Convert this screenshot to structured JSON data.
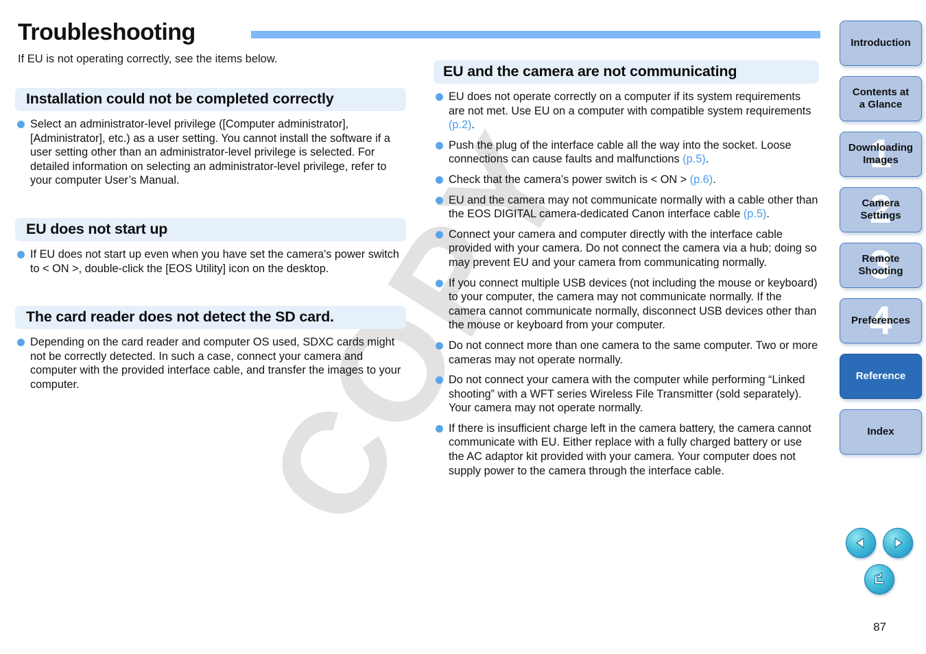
{
  "document": {
    "title": "Troubleshooting",
    "subtitle": "If EU is not operating correctly, see the items below.",
    "page_number": "87",
    "watermark": "COPY",
    "accent_color": "#7fb9f7",
    "section_head_bg": "#e6f0fb",
    "bullet_color": "#5aa4ea",
    "link_color": "#4a9bea",
    "active_tab_color": "#2b6cb8"
  },
  "left_column": {
    "sections": [
      {
        "heading": "Installation could not be completed correctly",
        "bullets": [
          "Select an administrator-level privilege ([Computer administrator], [Administrator], etc.) as a user setting. You cannot install the software if a user setting other than an administrator-level privilege is selected. For detailed information on selecting an administrator-level privilege, refer to your computer User’s Manual."
        ]
      },
      {
        "heading": "EU does not start up",
        "bullets": [
          "If EU does not start up even when you have set the camera's power switch to < ON >, double-click the [EOS Utility] icon on the desktop."
        ]
      },
      {
        "heading": "The card reader does not detect the SD card.",
        "bullets": [
          "Depending on the card reader and computer OS used, SDXC cards might not be correctly detected. In such a case, connect your camera and computer with the provided interface cable, and transfer the images to your computer."
        ]
      }
    ]
  },
  "right_column": {
    "sections": [
      {
        "heading": "EU and the camera are not communicating",
        "bullets": [
          {
            "text": "EU does not operate correctly on a computer if its system requirements are not met. Use EU on a computer with compatible system requirements ",
            "ref": "(p.2)",
            "tail": "."
          },
          {
            "text": "Push the plug of the interface cable all the way into the socket. Loose connections can cause faults and malfunctions ",
            "ref": "(p.5)",
            "tail": "."
          },
          {
            "text": "Check that the camera’s power switch is < ON > ",
            "ref": "(p.6)",
            "tail": "."
          },
          {
            "text": "EU and the camera may not communicate normally with a cable other than the EOS DIGITAL camera-dedicated Canon interface cable ",
            "ref": "(p.5)",
            "tail": "."
          },
          {
            "text": "Connect your camera and computer directly with the interface cable provided with your camera. Do not connect the camera via a hub; doing so may prevent EU and your camera from communicating normally.",
            "ref": "",
            "tail": ""
          },
          {
            "text": "If you connect multiple USB devices (not including the mouse or keyboard) to your computer, the camera may not communicate normally. If the camera cannot communicate normally, disconnect USB devices other than the mouse or keyboard from your computer.",
            "ref": "",
            "tail": ""
          },
          {
            "text": "Do not connect more than one camera to the same computer. Two or more cameras may not operate normally.",
            "ref": "",
            "tail": ""
          },
          {
            "text": "Do not connect your camera with the computer while performing “Linked shooting” with a WFT series Wireless File Transmitter (sold separately). Your camera may not operate normally.",
            "ref": "",
            "tail": ""
          },
          {
            "text": "If there is insufficient charge left in the camera battery, the camera cannot communicate with EU. Either replace with a fully charged battery or use the AC adaptor kit provided with your camera. Your computer does not supply power to the camera through the interface cable.",
            "ref": "",
            "tail": ""
          }
        ]
      }
    ]
  },
  "sidebar": {
    "tabs": [
      {
        "label": "Introduction",
        "number": "",
        "active": false
      },
      {
        "label": "Contents at\na Glance",
        "number": "",
        "active": false
      },
      {
        "label": "Downloading\nImages",
        "number": "1",
        "active": false
      },
      {
        "label": "Camera\nSettings",
        "number": "2",
        "active": false
      },
      {
        "label": "Remote\nShooting",
        "number": "3",
        "active": false
      },
      {
        "label": "Preferences",
        "number": "4",
        "active": false
      },
      {
        "label": "Reference",
        "number": "",
        "active": true
      },
      {
        "label": "Index",
        "number": "",
        "active": false
      }
    ]
  },
  "nav_buttons": {
    "previous": "previous-page",
    "next": "next-page",
    "return": "return-page"
  }
}
